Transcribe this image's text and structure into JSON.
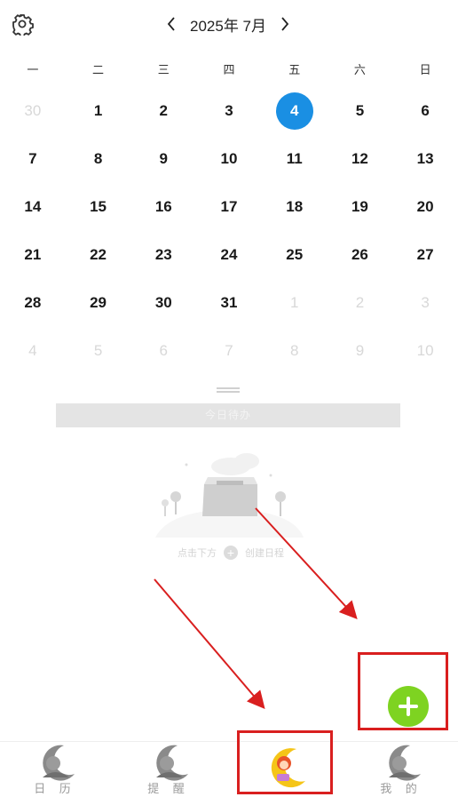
{
  "header": {
    "title": "2025年 7月",
    "settings_icon": "gear-icon",
    "prev_icon": "chevron-left-icon",
    "next_icon": "chevron-right-icon"
  },
  "weekdays": [
    "一",
    "二",
    "三",
    "四",
    "五",
    "六",
    "日"
  ],
  "calendar": {
    "today": "4",
    "days": [
      {
        "d": "30",
        "dim": true
      },
      {
        "d": "1"
      },
      {
        "d": "2"
      },
      {
        "d": "3"
      },
      {
        "d": "4",
        "today": true
      },
      {
        "d": "5"
      },
      {
        "d": "6"
      },
      {
        "d": "7"
      },
      {
        "d": "8"
      },
      {
        "d": "9"
      },
      {
        "d": "10"
      },
      {
        "d": "11"
      },
      {
        "d": "12"
      },
      {
        "d": "13"
      },
      {
        "d": "14"
      },
      {
        "d": "15"
      },
      {
        "d": "16"
      },
      {
        "d": "17"
      },
      {
        "d": "18"
      },
      {
        "d": "19"
      },
      {
        "d": "20"
      },
      {
        "d": "21"
      },
      {
        "d": "22"
      },
      {
        "d": "23"
      },
      {
        "d": "24"
      },
      {
        "d": "25"
      },
      {
        "d": "26"
      },
      {
        "d": "27"
      },
      {
        "d": "28"
      },
      {
        "d": "29"
      },
      {
        "d": "30"
      },
      {
        "d": "31"
      },
      {
        "d": "1",
        "dim": true
      },
      {
        "d": "2",
        "dim": true
      },
      {
        "d": "3",
        "dim": true
      },
      {
        "d": "4",
        "dim": true
      },
      {
        "d": "5",
        "dim": true
      },
      {
        "d": "6",
        "dim": true
      },
      {
        "d": "7",
        "dim": true
      },
      {
        "d": "8",
        "dim": true
      },
      {
        "d": "9",
        "dim": true
      },
      {
        "d": "10",
        "dim": true
      }
    ]
  },
  "todo_bar": {
    "label": "今日待办"
  },
  "empty_state": {
    "hint_left": "点击下方",
    "hint_right": "创建日程"
  },
  "fab": {
    "icon": "plus-icon",
    "color": "#7ed321"
  },
  "colors": {
    "accent": "#1a8fe3",
    "annotation": "#d91f1f",
    "fab": "#7ed321"
  },
  "tabs": [
    {
      "label": "日 历",
      "icon": "character-moon-icon"
    },
    {
      "label": "提 醒",
      "icon": "character-moon-icon"
    },
    {
      "label": "",
      "icon": "character-moon-icon-active"
    },
    {
      "label": "我 的",
      "icon": "character-moon-icon"
    }
  ]
}
